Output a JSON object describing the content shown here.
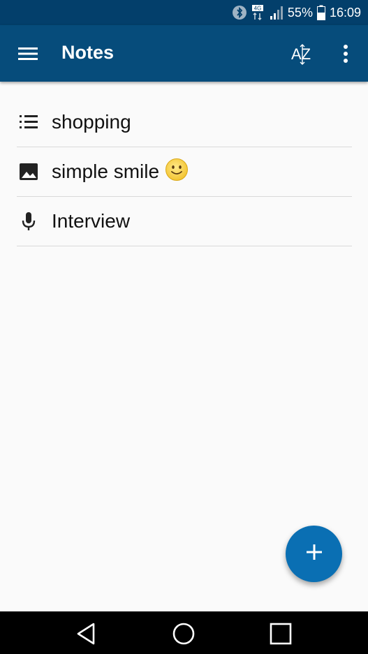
{
  "status_bar": {
    "battery_percent": "55%",
    "time": "16:09",
    "network_label": "4G",
    "icons": [
      "bluetooth-icon",
      "network-icon",
      "signal-icon",
      "battery-icon"
    ]
  },
  "app_bar": {
    "title": "Notes",
    "sort_label": "AZ",
    "icons": [
      "hamburger-menu-icon",
      "sort-az-icon",
      "more-vert-icon"
    ],
    "background": "#064c7b"
  },
  "notes": [
    {
      "title": "shopping",
      "icon": "checklist-icon"
    },
    {
      "title": "simple smile",
      "icon": "image-icon",
      "emoji": "smiley-emoji"
    },
    {
      "title": "Interview",
      "icon": "microphone-icon"
    }
  ],
  "fab": {
    "icon": "plus-icon",
    "color": "#0a6fb3"
  },
  "nav_bar": {
    "icons": [
      "back-icon",
      "home-icon",
      "recents-icon"
    ]
  }
}
